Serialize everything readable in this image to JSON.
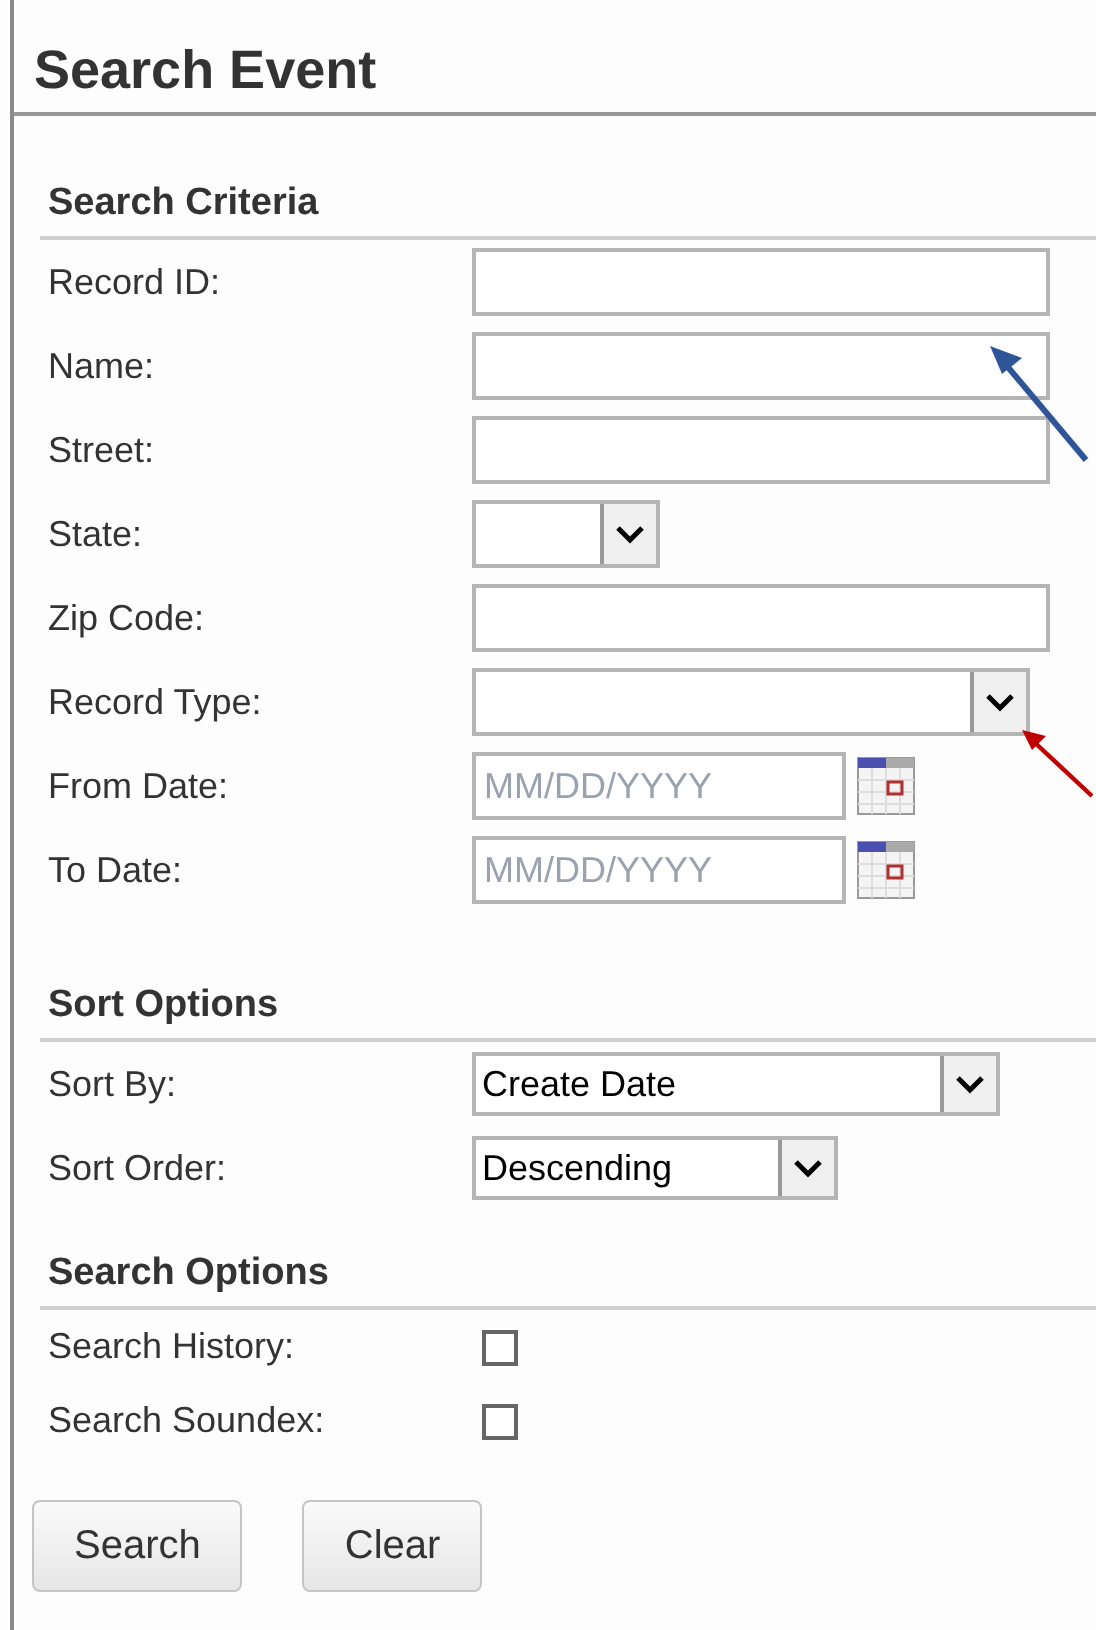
{
  "title": "Search Event",
  "sections": [
    {
      "heading": "Search Criteria",
      "rows": [
        {
          "label": "Record ID:",
          "kind": "text"
        },
        {
          "label": "Name:",
          "kind": "text"
        },
        {
          "label": "Street:",
          "kind": "text"
        },
        {
          "label": "State:",
          "kind": "select"
        },
        {
          "label": "Zip Code:",
          "kind": "text"
        },
        {
          "label": "Record Type:",
          "kind": "select"
        },
        {
          "label": "From Date:",
          "kind": "date",
          "placeholder": "MM/DD/YYYY"
        },
        {
          "label": "To Date:",
          "kind": "date",
          "placeholder": "MM/DD/YYYY"
        }
      ]
    },
    {
      "heading": "Sort Options",
      "rows": [
        {
          "label": "Sort By:",
          "kind": "select",
          "value": "Create Date"
        },
        {
          "label": "Sort Order:",
          "kind": "select",
          "value": "Descending"
        }
      ]
    },
    {
      "heading": "Search Options",
      "rows": [
        {
          "label": "Search History:",
          "kind": "checkbox",
          "checked": false
        },
        {
          "label": "Search Soundex:",
          "kind": "checkbox",
          "checked": false
        }
      ]
    }
  ],
  "buttons": [
    "Search",
    "Clear"
  ],
  "annotations": [
    {
      "color": "#2e5597"
    },
    {
      "color": "#c00000"
    }
  ]
}
